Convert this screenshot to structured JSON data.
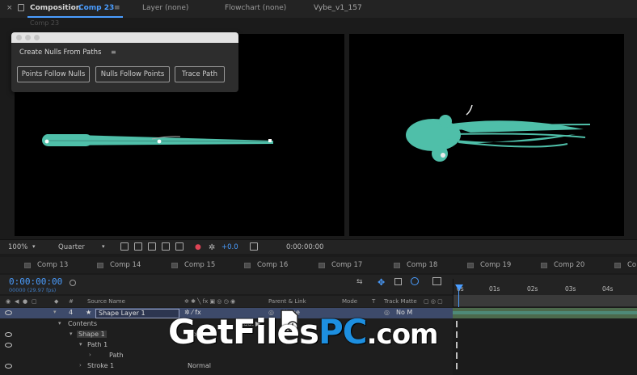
{
  "top_bar": {
    "close": "×",
    "comp_prefix": "Composition",
    "comp_name": "Comp 23",
    "menu": "≡",
    "layer_panel": "Layer (none)",
    "flowchart": "Flowchart (none)",
    "project": "Vybe_v1_157"
  },
  "sub_tab": "Comp 23",
  "dialog": {
    "title": "Create Nulls From Paths",
    "menu": "≡",
    "buttons": [
      "Points Follow Nulls",
      "Nulls Follow Points",
      "Trace Path"
    ]
  },
  "viewer_toolbar": {
    "zoom": "100%",
    "resolution": "Quarter",
    "exposure": "+0.0",
    "timecode": "0:00:00:00"
  },
  "timeline_tabs": [
    "Comp 13",
    "Comp 14",
    "Comp 15",
    "Comp 16",
    "Comp 17",
    "Comp 18",
    "Comp 19",
    "Comp 20",
    "Co"
  ],
  "timeline": {
    "timecode": "0:00:00:00",
    "fps": "00000 (29.97 fps)",
    "columns": {
      "num": "#",
      "source_name": "Source Name",
      "parent": "Parent & Link",
      "mode": "Mode",
      "t": "T",
      "track_matte": "Track Matte"
    },
    "ruler_ticks": [
      "0s",
      "01s",
      "02s",
      "03s",
      "04s"
    ]
  },
  "layers": {
    "main": {
      "index": "4",
      "name": "Shape Layer 1",
      "parent": "None",
      "matte": "No M"
    },
    "rows": [
      {
        "label": "Contents",
        "extra": "Add:"
      },
      {
        "label": "Shape 1",
        "mode": "Normal"
      },
      {
        "label": "Path 1"
      },
      {
        "label": "Path"
      },
      {
        "label": "Stroke 1",
        "mode": "Normal"
      }
    ]
  },
  "watermark": {
    "get": "GetFiles",
    "pc": "PC",
    "dotcom": ".com"
  },
  "colors": {
    "accent": "#4a9dff",
    "shape": "#4fbfa9"
  }
}
